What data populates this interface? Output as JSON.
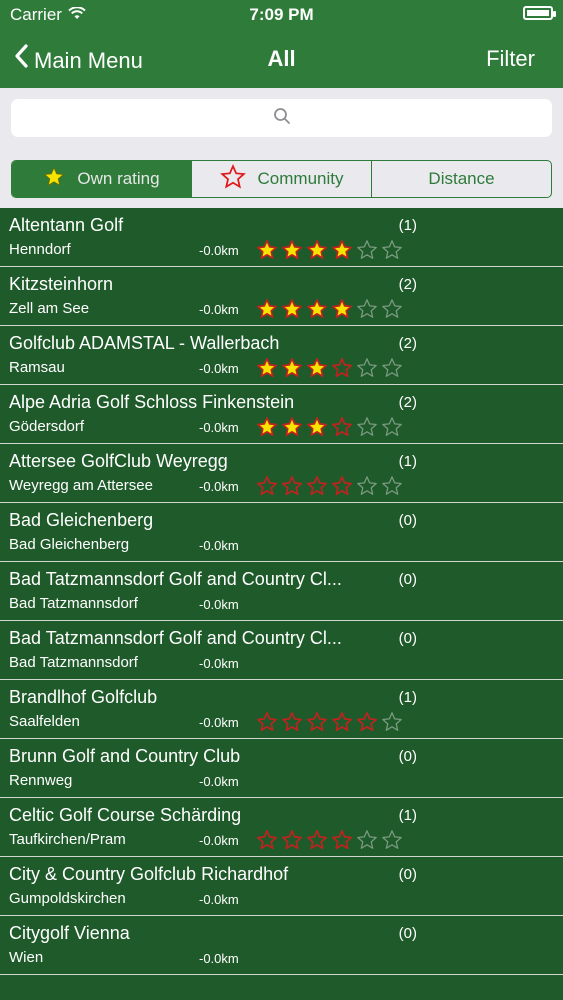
{
  "status": {
    "carrier": "Carrier",
    "time": "7:09 PM",
    "battery_level": 1.0
  },
  "nav": {
    "back_label": "Main Menu",
    "title": "All",
    "filter_label": "Filter"
  },
  "search": {
    "placeholder": "",
    "value": ""
  },
  "segments": [
    {
      "label": "Own rating",
      "icon": "star-filled-icon",
      "active": true
    },
    {
      "label": "Community",
      "icon": "star-outline-icon",
      "active": false
    },
    {
      "label": "Distance",
      "icon": "",
      "active": false
    }
  ],
  "list": [
    {
      "name": "Altentann Golf",
      "city": "Henndorf",
      "distance": "-0.0km",
      "count": "(1)",
      "stars": [
        "filled",
        "filled",
        "filled",
        "filled",
        "empty",
        "empty"
      ]
    },
    {
      "name": "Kitzsteinhorn",
      "city": "Zell am See",
      "distance": "-0.0km",
      "count": "(2)",
      "stars": [
        "filled",
        "filled",
        "filled",
        "filled",
        "empty",
        "empty"
      ]
    },
    {
      "name": "Golfclub ADAMSTAL - Wallerbach",
      "city": "Ramsau",
      "distance": "-0.0km",
      "count": "(2)",
      "stars": [
        "filled",
        "filled",
        "filled",
        "red",
        "empty",
        "empty"
      ]
    },
    {
      "name": "Alpe Adria Golf Schloss Finkenstein",
      "city": "Gödersdorf",
      "distance": "-0.0km",
      "count": "(2)",
      "stars": [
        "filled",
        "filled",
        "filled",
        "red",
        "empty",
        "empty"
      ]
    },
    {
      "name": "Attersee GolfClub Weyregg",
      "city": "Weyregg am Attersee",
      "distance": "-0.0km",
      "count": "(1)",
      "stars": [
        "red",
        "red",
        "red",
        "red",
        "empty",
        "empty"
      ]
    },
    {
      "name": "Bad Gleichenberg",
      "city": "Bad Gleichenberg",
      "distance": "-0.0km",
      "count": "(0)",
      "stars": []
    },
    {
      "name": "Bad Tatzmannsdorf Golf and Country Cl...",
      "city": "Bad Tatzmannsdorf",
      "distance": "-0.0km",
      "count": "(0)",
      "stars": []
    },
    {
      "name": "Bad Tatzmannsdorf Golf and Country Cl...",
      "city": "Bad Tatzmannsdorf",
      "distance": "-0.0km",
      "count": "(0)",
      "stars": []
    },
    {
      "name": "Brandlhof Golfclub",
      "city": "Saalfelden",
      "distance": "-0.0km",
      "count": "(1)",
      "stars": [
        "red",
        "red",
        "red",
        "red",
        "red",
        "empty"
      ]
    },
    {
      "name": "Brunn Golf and Country Club",
      "city": "Rennweg",
      "distance": "-0.0km",
      "count": "(0)",
      "stars": []
    },
    {
      "name": "Celtic Golf Course Schärding",
      "city": "Taufkirchen/Pram",
      "distance": "-0.0km",
      "count": "(1)",
      "stars": [
        "red",
        "red",
        "red",
        "red",
        "empty",
        "empty"
      ]
    },
    {
      "name": "City & Country Golfclub Richardhof",
      "city": "Gumpoldskirchen",
      "distance": "-0.0km",
      "count": "(0)",
      "stars": []
    },
    {
      "name": "Citygolf Vienna",
      "city": "Wien",
      "distance": "-0.0km",
      "count": "(0)",
      "stars": []
    }
  ],
  "colors": {
    "nav_green": "#2f7b3a",
    "list_green": "#1f5a2a",
    "star_yellow": "#f7e300",
    "star_red": "#c0231f"
  }
}
